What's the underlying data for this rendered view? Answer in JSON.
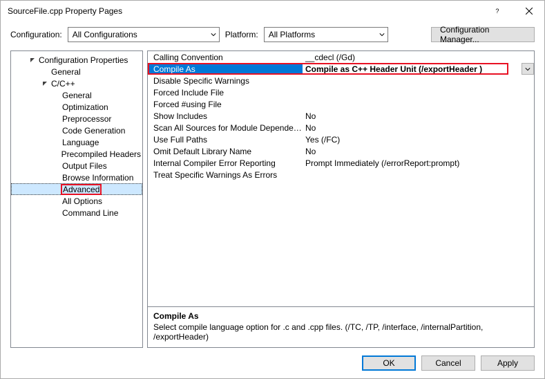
{
  "window": {
    "title": "SourceFile.cpp Property Pages"
  },
  "config_row": {
    "label_config": "Configuration:",
    "combo_config": "All Configurations",
    "label_platform": "Platform:",
    "combo_platform": "All Platforms",
    "btn_manager": "Configuration Manager..."
  },
  "tree": {
    "root": "Configuration Properties",
    "general": "General",
    "cpp": "C/C++",
    "cpp_children": {
      "general": "General",
      "optimization": "Optimization",
      "preprocessor": "Preprocessor",
      "code_gen": "Code Generation",
      "language": "Language",
      "pch": "Precompiled Headers",
      "output": "Output Files",
      "browse": "Browse Information",
      "advanced": "Advanced",
      "all_options": "All Options",
      "cmdline": "Command Line"
    }
  },
  "grid": [
    {
      "name": "Calling Convention",
      "value": "__cdecl (/Gd)"
    },
    {
      "name": "Compile As",
      "value": "Compile as C++ Header Unit (/exportHeader )"
    },
    {
      "name": "Disable Specific Warnings",
      "value": ""
    },
    {
      "name": "Forced Include File",
      "value": ""
    },
    {
      "name": "Forced #using File",
      "value": ""
    },
    {
      "name": "Show Includes",
      "value": "No"
    },
    {
      "name": "Scan All Sources for Module Dependencies",
      "value": "No"
    },
    {
      "name": "Use Full Paths",
      "value": "Yes (/FC)"
    },
    {
      "name": "Omit Default Library Name",
      "value": "No"
    },
    {
      "name": "Internal Compiler Error Reporting",
      "value": "Prompt Immediately (/errorReport:prompt)"
    },
    {
      "name": "Treat Specific Warnings As Errors",
      "value": ""
    }
  ],
  "desc": {
    "title": "Compile As",
    "body": "Select compile language option for .c and .cpp files.    (/TC, /TP, /interface, /internalPartition, /exportHeader)"
  },
  "footer": {
    "ok": "OK",
    "cancel": "Cancel",
    "apply": "Apply"
  }
}
